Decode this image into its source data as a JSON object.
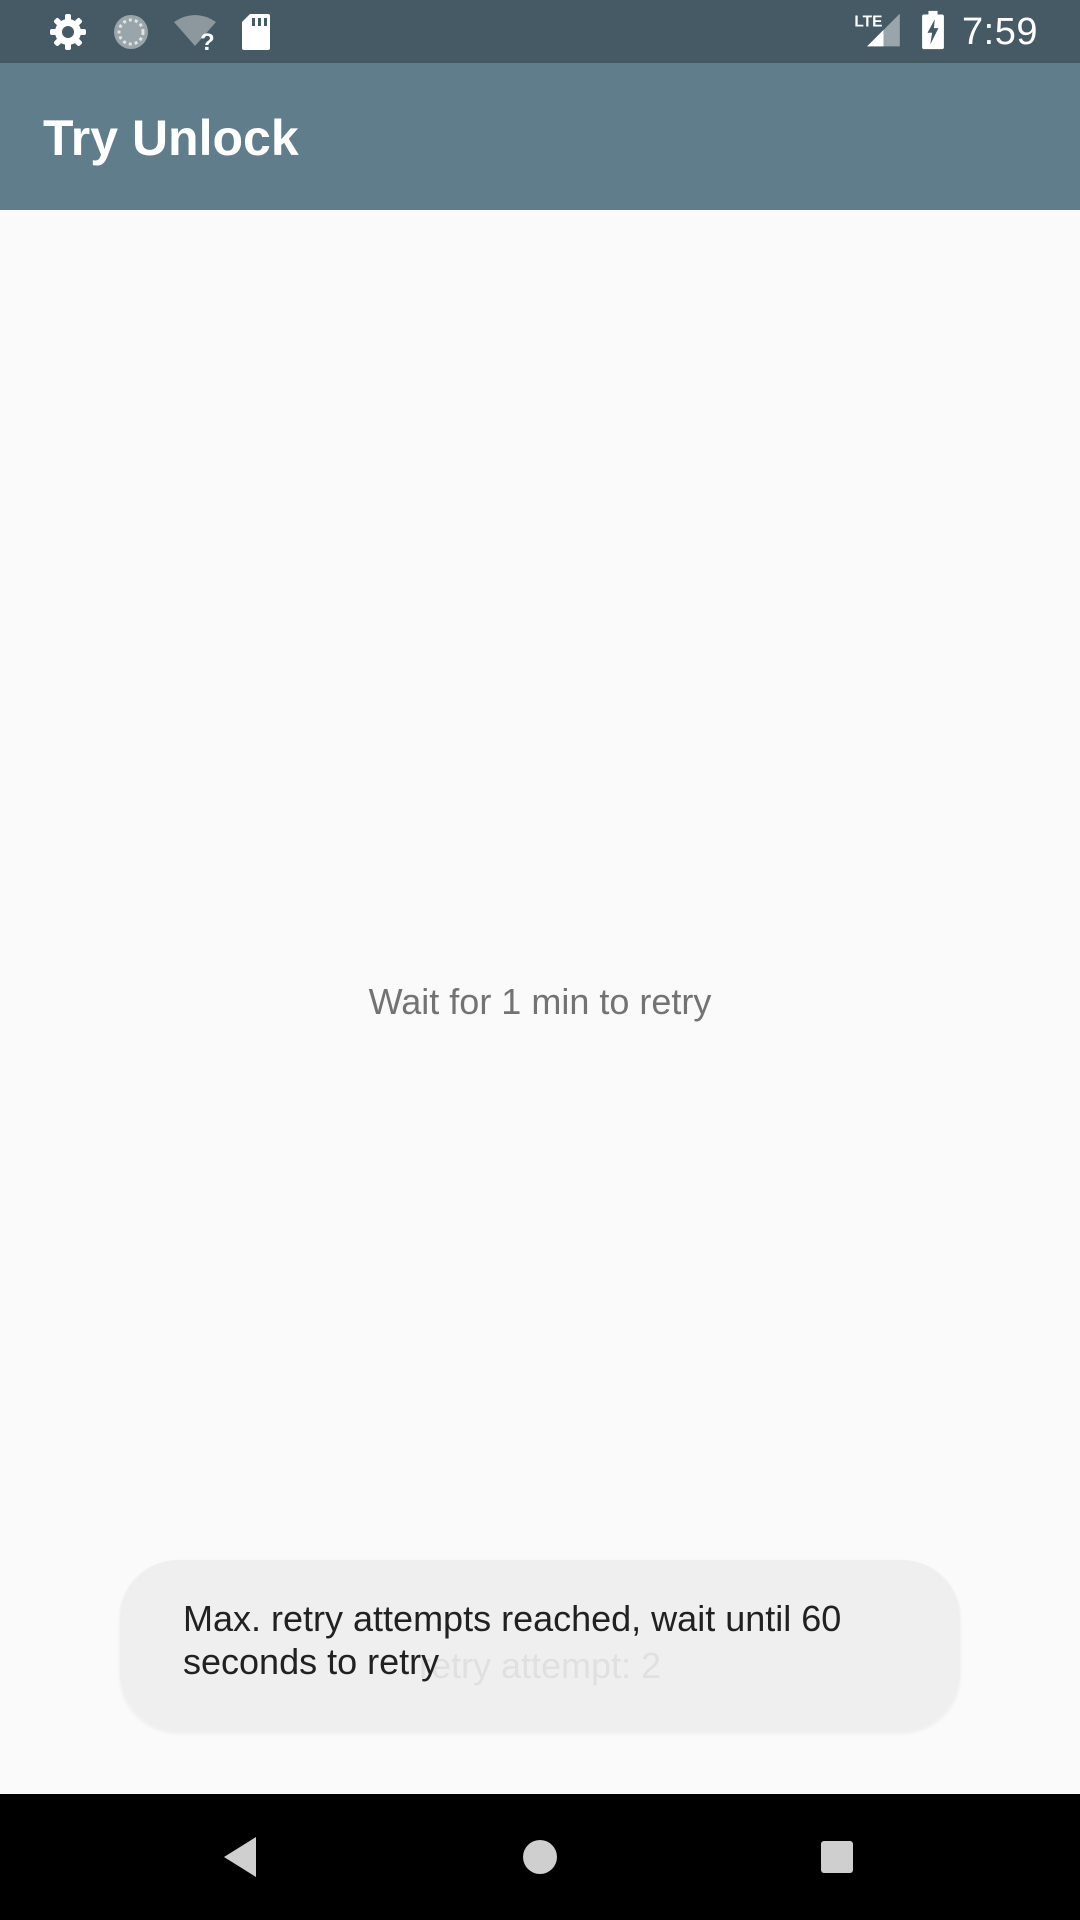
{
  "status_bar": {
    "time": "7:59",
    "network_label": "LTE",
    "icons": [
      "gear-icon",
      "sync-icon",
      "wifi-unknown-icon",
      "sd-card-icon",
      "cell-signal-icon",
      "battery-charging-icon"
    ]
  },
  "app_bar": {
    "title": "Try Unlock"
  },
  "main": {
    "wait_message": "Wait for 1 min to retry"
  },
  "toast": {
    "message": "Max. retry attempts reached, wait until 60 seconds to retry",
    "previous_message_fragment": "retry attempt: 2"
  },
  "nav_bar": {
    "buttons": [
      "back-icon",
      "home-icon",
      "recents-icon"
    ]
  },
  "colors": {
    "status_bar": "#455a64",
    "app_bar": "#607d8b",
    "background": "#fafafa",
    "toast": "#eeeeee",
    "nav_bar": "#000000"
  }
}
